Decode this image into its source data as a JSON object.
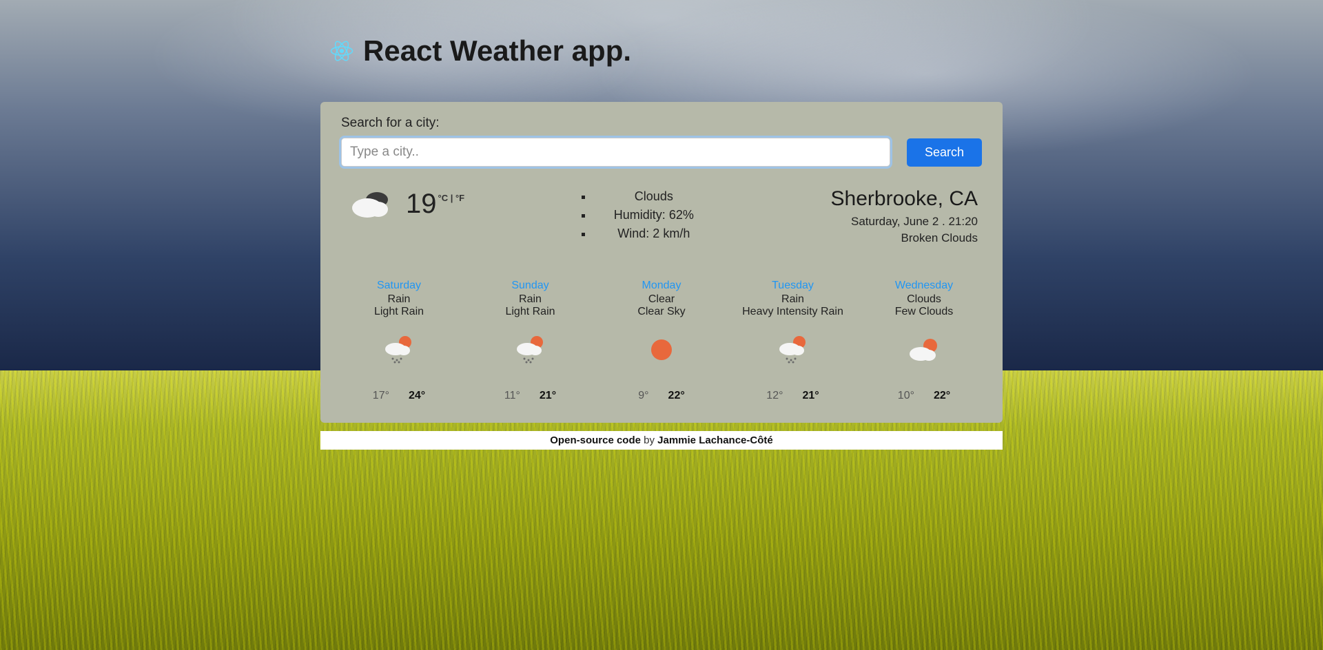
{
  "header": {
    "title": "React Weather app."
  },
  "search": {
    "label": "Search for a city:",
    "placeholder": "Type a city..",
    "button": "Search"
  },
  "current": {
    "temp": "19",
    "units": "°C | °F",
    "details": {
      "condition": "Clouds",
      "humidity": "Humidity: 62%",
      "wind": "Wind: 2 km/h"
    },
    "location": "Sherbrooke, CA",
    "datetime": "Saturday, June 2 . 21:20",
    "description": "Broken Clouds"
  },
  "forecast": [
    {
      "day": "Saturday",
      "main": "Rain",
      "desc": "Light Rain",
      "low": "17°",
      "high": "24°",
      "icon": "rain-sun"
    },
    {
      "day": "Sunday",
      "main": "Rain",
      "desc": "Light Rain",
      "low": "11°",
      "high": "21°",
      "icon": "rain-sun"
    },
    {
      "day": "Monday",
      "main": "Clear",
      "desc": "Clear Sky",
      "low": "9°",
      "high": "22°",
      "icon": "sun"
    },
    {
      "day": "Tuesday",
      "main": "Rain",
      "desc": "Heavy Intensity Rain",
      "low": "12°",
      "high": "21°",
      "icon": "rain-sun"
    },
    {
      "day": "Wednesday",
      "main": "Clouds",
      "desc": "Few Clouds",
      "low": "10°",
      "high": "22°",
      "icon": "cloud-sun"
    }
  ],
  "footer": {
    "oss": "Open-source code",
    "by": " by ",
    "author": "Jammie Lachance-Côté"
  }
}
